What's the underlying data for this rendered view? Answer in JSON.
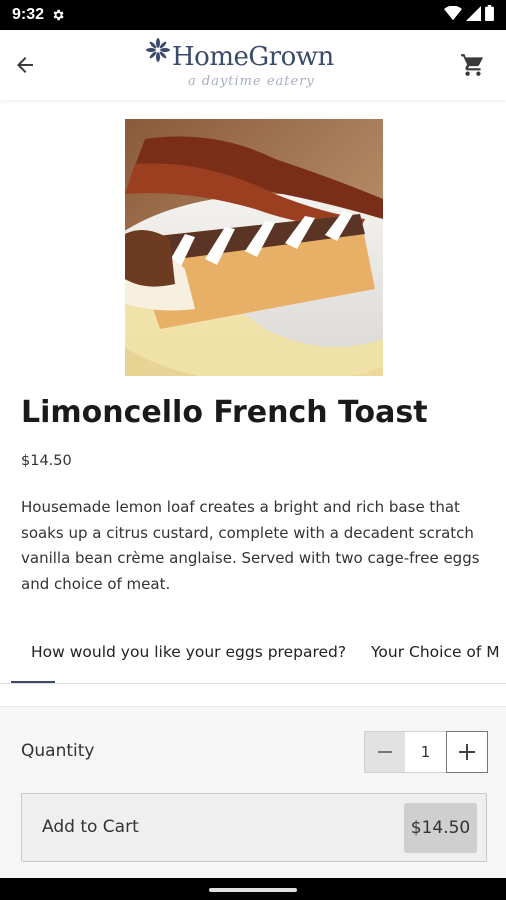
{
  "status_bar": {
    "time": "9:32",
    "icons": [
      "gear-icon",
      "wifi-icon",
      "cellular-signal-icon",
      "battery-icon"
    ]
  },
  "header": {
    "logo_text": "HomeGrown",
    "logo_tagline": "a daytime eatery",
    "back_icon": "arrow-left-icon",
    "cart_icon": "shopping-cart-icon"
  },
  "product": {
    "image": "french-toast-photo",
    "title": "Limoncello French Toast",
    "price": "$14.50",
    "description": "Housemade lemon loaf creates a bright and rich base that soaks up a citrus custard, complete with a decadent scratch vanilla bean crème anglaise. Served with two cage-free eggs and choice of meat."
  },
  "tabs": [
    {
      "label": "How would you like your eggs prepared?",
      "active": true
    },
    {
      "label": "Your Choice of M",
      "active": false
    }
  ],
  "order": {
    "quantity_label": "Quantity",
    "quantity_value": "1",
    "add_to_cart_label": "Add to Cart",
    "add_to_cart_price": "$14.50"
  },
  "colors": {
    "brand": "#3b4a6b",
    "panel_bg": "#f6f6f6"
  }
}
